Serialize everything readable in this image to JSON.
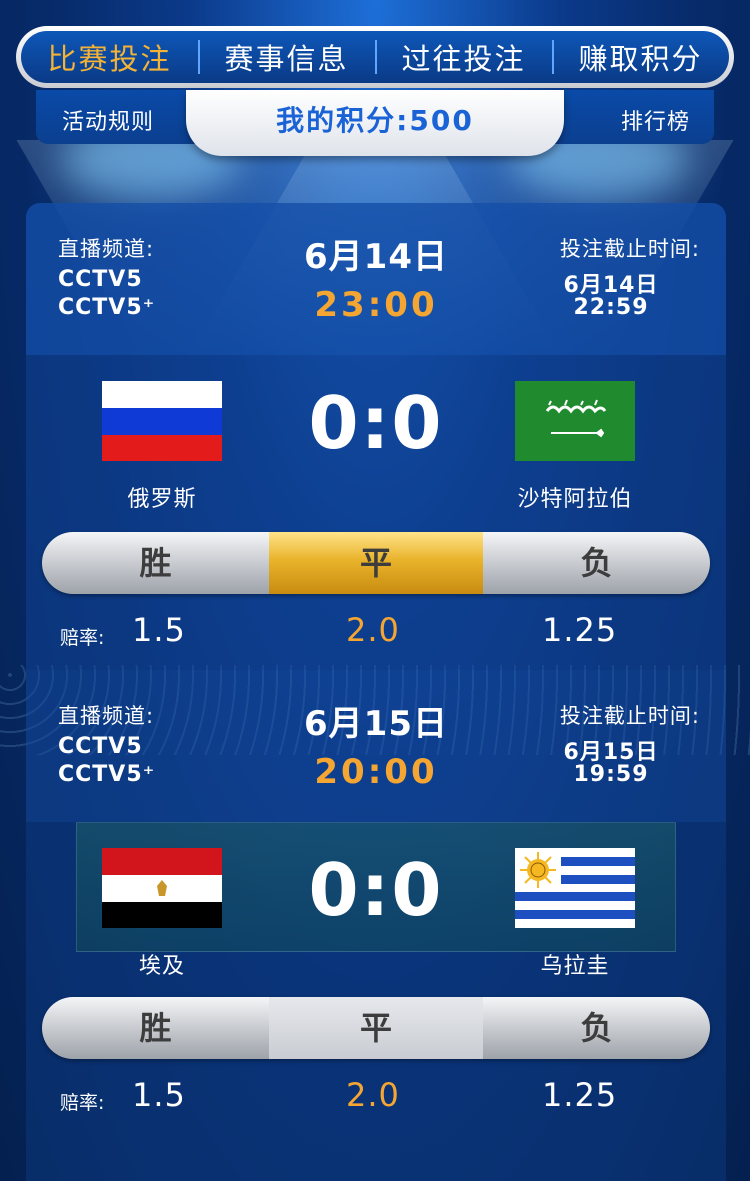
{
  "nav": {
    "tabs": [
      "比赛投注",
      "赛事信息",
      "过往投注",
      "赚取积分"
    ],
    "active_index": 0
  },
  "subbar": {
    "rules_label": "活动规则",
    "points_label": "我的积分:500",
    "ranking_label": "排行榜"
  },
  "matches": [
    {
      "channel_label": "直播频道:",
      "channels": [
        "CCTV5",
        "CCTV5⁺"
      ],
      "date": "6月14日",
      "time": "23:00",
      "deadline_label": "投注截止时间:",
      "deadline_date": "6月14日",
      "deadline_time": "22:59",
      "home_team": "俄罗斯",
      "away_team": "沙特阿拉伯",
      "home_flag_icon": "russia-flag-icon",
      "away_flag_icon": "saudi-arabia-flag-icon",
      "score": "0:0",
      "bet_options": [
        "胜",
        "平",
        "负"
      ],
      "selected_option": "平",
      "odds_label": "赔率:",
      "odds": [
        "1.5",
        "2.0",
        "1.25"
      ]
    },
    {
      "channel_label": "直播频道:",
      "channels": [
        "CCTV5",
        "CCTV5⁺"
      ],
      "date": "6月15日",
      "time": "20:00",
      "deadline_label": "投注截止时间:",
      "deadline_date": "6月15日",
      "deadline_time": "19:59",
      "home_team": "埃及",
      "away_team": "乌拉圭",
      "home_flag_icon": "egypt-flag-icon",
      "away_flag_icon": "uruguay-flag-icon",
      "score": "0:0",
      "bet_options": [
        "胜",
        "平",
        "负"
      ],
      "selected_option": "",
      "odds_label": "赔率:",
      "odds": [
        "1.5",
        "2.0",
        "1.25"
      ]
    }
  ],
  "colors": {
    "accent_orange": "#f5a632",
    "active_tab": "#f5b335",
    "points_blue": "#1a63d6",
    "selected_gold": "#e9b32b"
  }
}
